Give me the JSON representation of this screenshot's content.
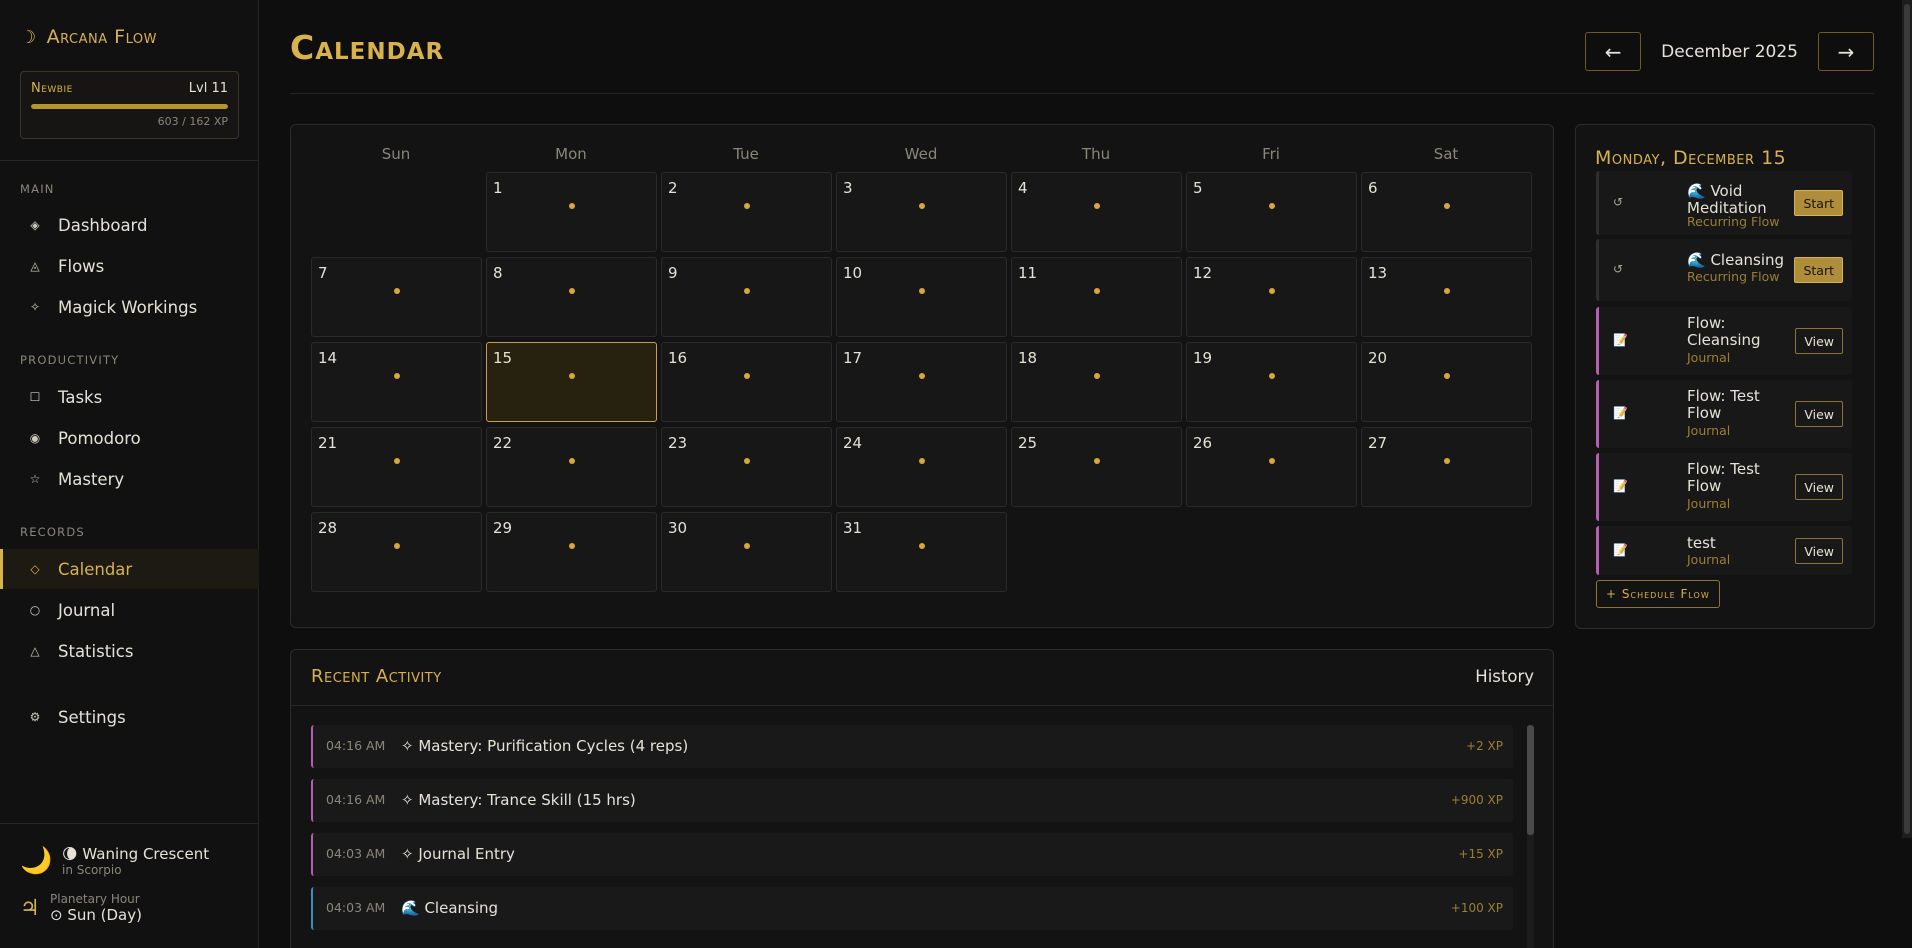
{
  "app": {
    "name": "Arcana Flow",
    "moon_icon": "☽"
  },
  "level": {
    "rank": "Newbie",
    "level_label": "Lvl 11",
    "xp_text": "603 / 162 XP",
    "progress": 1.0
  },
  "sidebar": {
    "sections": [
      "Main",
      "Productivity",
      "Records"
    ],
    "items": [
      {
        "label": "Dashboard",
        "icon": "◈"
      },
      {
        "label": "Flows",
        "icon": "◬"
      },
      {
        "label": "Magick Workings",
        "icon": "✧"
      },
      {
        "label": "Tasks",
        "icon": "☐"
      },
      {
        "label": "Pomodoro",
        "icon": "◉"
      },
      {
        "label": "Mastery",
        "icon": "☆"
      },
      {
        "label": "Calendar",
        "icon": "◇"
      },
      {
        "label": "Journal",
        "icon": "○"
      },
      {
        "label": "Statistics",
        "icon": "△"
      },
      {
        "label": "Settings",
        "icon": "⚙"
      }
    ]
  },
  "moon": {
    "icon": "🌙",
    "phase_icon": "🌘",
    "phase": "Waning Crescent",
    "sign": "in Scorpio"
  },
  "planetary": {
    "symbol": "♃",
    "label": "Planetary Hour",
    "value": "⊙ Sun (Day)"
  },
  "header": {
    "title": "Calendar",
    "prev": "←",
    "next": "→",
    "month": "December 2025"
  },
  "calendar": {
    "weekdays": [
      "Sun",
      "Mon",
      "Tue",
      "Wed",
      "Thu",
      "Fri",
      "Sat"
    ],
    "days": [
      "1",
      "2",
      "3",
      "4",
      "5",
      "6",
      "7",
      "8",
      "9",
      "10",
      "11",
      "12",
      "13",
      "14",
      "15",
      "16",
      "17",
      "18",
      "19",
      "20",
      "21",
      "22",
      "23",
      "24",
      "25",
      "26",
      "27",
      "28",
      "29",
      "30",
      "31"
    ],
    "today": "15"
  },
  "selected_day": {
    "title": "Monday, December 15",
    "events": [
      {
        "icon": "↺",
        "name": "🌊 Void Meditation",
        "type": "Recurring Flow",
        "action": "Start"
      },
      {
        "icon": "↺",
        "name": "🌊 Cleansing",
        "type": "Recurring Flow",
        "action": "Start"
      },
      {
        "icon": "📝",
        "name": "Flow: Cleansing",
        "type": "Journal",
        "action": "View"
      },
      {
        "icon": "📝",
        "name": "Flow: Test Flow",
        "type": "Journal",
        "action": "View"
      },
      {
        "icon": "📝",
        "name": "Flow: Test Flow",
        "type": "Journal",
        "action": "View"
      },
      {
        "icon": "📝",
        "name": "test",
        "type": "Journal",
        "action": "View"
      }
    ],
    "schedule_label": "+ Schedule Flow"
  },
  "activity": {
    "title": "Recent Activity",
    "history_label": "History",
    "rows": [
      {
        "time": "04:16 AM",
        "text": "✧ Mastery: Purification Cycles (4 reps)",
        "xp": "+2 XP"
      },
      {
        "time": "04:16 AM",
        "text": "✧ Mastery: Trance Skill (15 hrs)",
        "xp": "+900 XP"
      },
      {
        "time": "04:03 AM",
        "text": "✧ Journal Entry",
        "xp": "+15 XP"
      },
      {
        "time": "04:03 AM",
        "text": "🌊 Cleansing",
        "xp": "+100 XP"
      }
    ]
  }
}
